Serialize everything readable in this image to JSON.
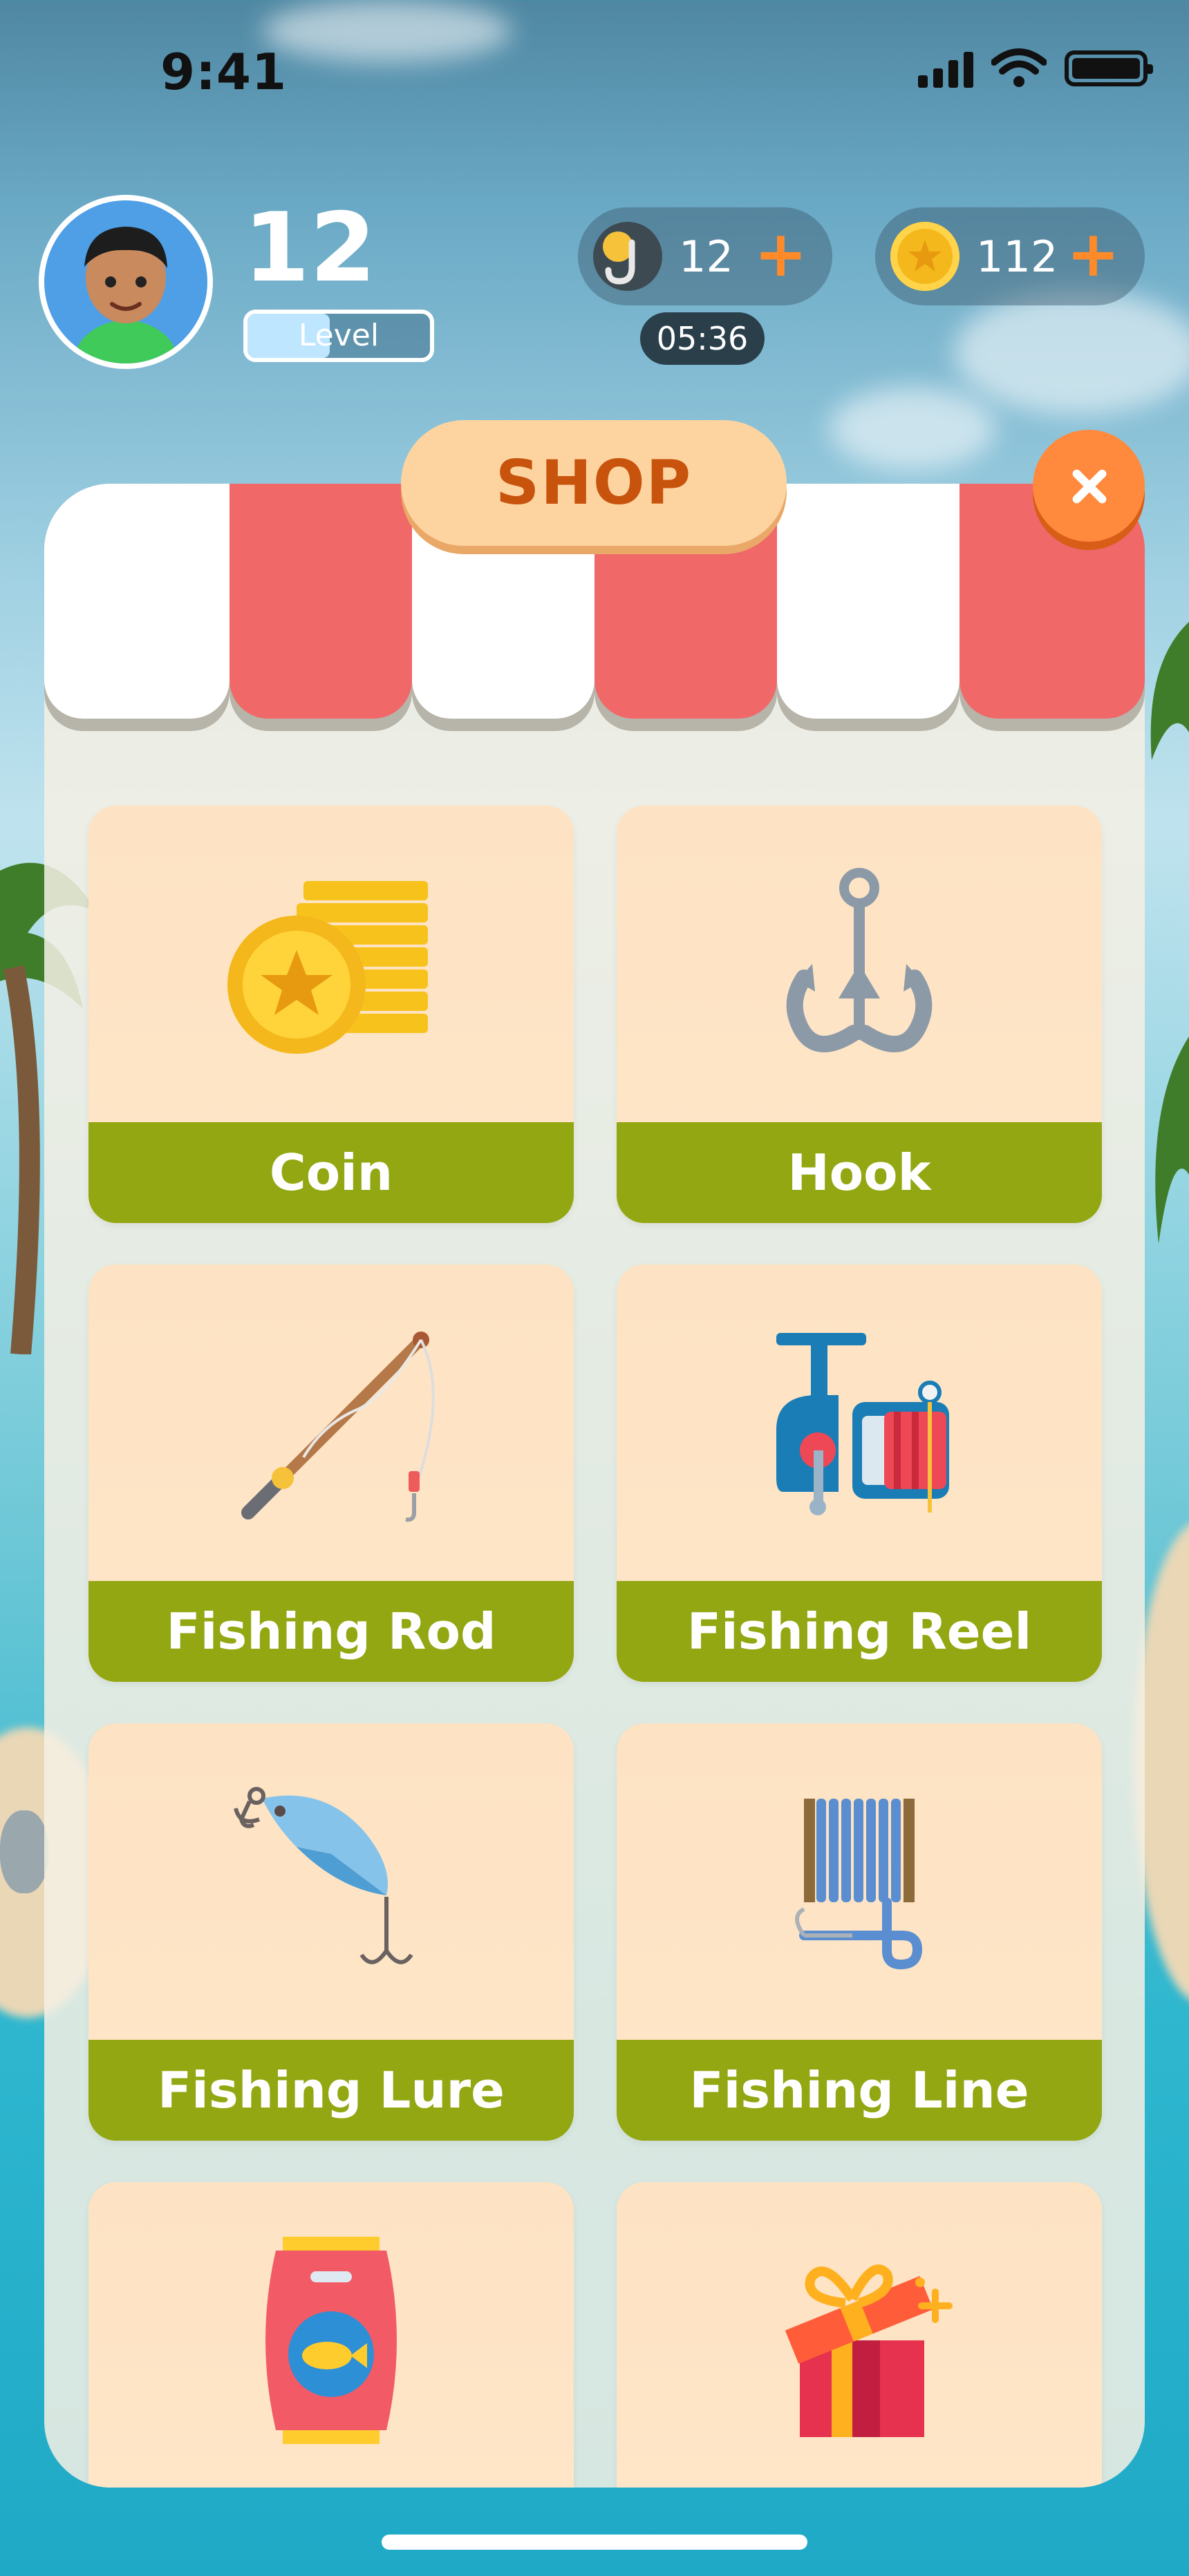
{
  "status_bar": {
    "time": "9:41"
  },
  "player": {
    "level": "12",
    "level_label": "Level",
    "level_progress": 0.45
  },
  "resources": {
    "hooks": {
      "value": "12",
      "plus": "+",
      "timer": "05:36"
    },
    "coins": {
      "value": "112",
      "plus": "+"
    }
  },
  "shop": {
    "title": "SHOP",
    "close_icon": "close-icon",
    "items": [
      {
        "label": "Coin",
        "icon": "coin-stack-icon"
      },
      {
        "label": "Hook",
        "icon": "hook-icon"
      },
      {
        "label": "Fishing Rod",
        "icon": "fishing-rod-icon"
      },
      {
        "label": "Fishing Reel",
        "icon": "fishing-reel-icon"
      },
      {
        "label": "Fishing Lure",
        "icon": "fishing-lure-icon"
      },
      {
        "label": "Fishing Line",
        "icon": "fishing-line-icon"
      },
      {
        "label": "",
        "icon": "fish-bait-bag-icon"
      },
      {
        "label": "",
        "icon": "gift-box-icon"
      }
    ]
  },
  "colors": {
    "awning_red": "#f06868",
    "awning_white": "#ffffff",
    "label_green": "#93a712",
    "accent_orange": "#ff8a3d",
    "title_text": "#c8530d"
  }
}
